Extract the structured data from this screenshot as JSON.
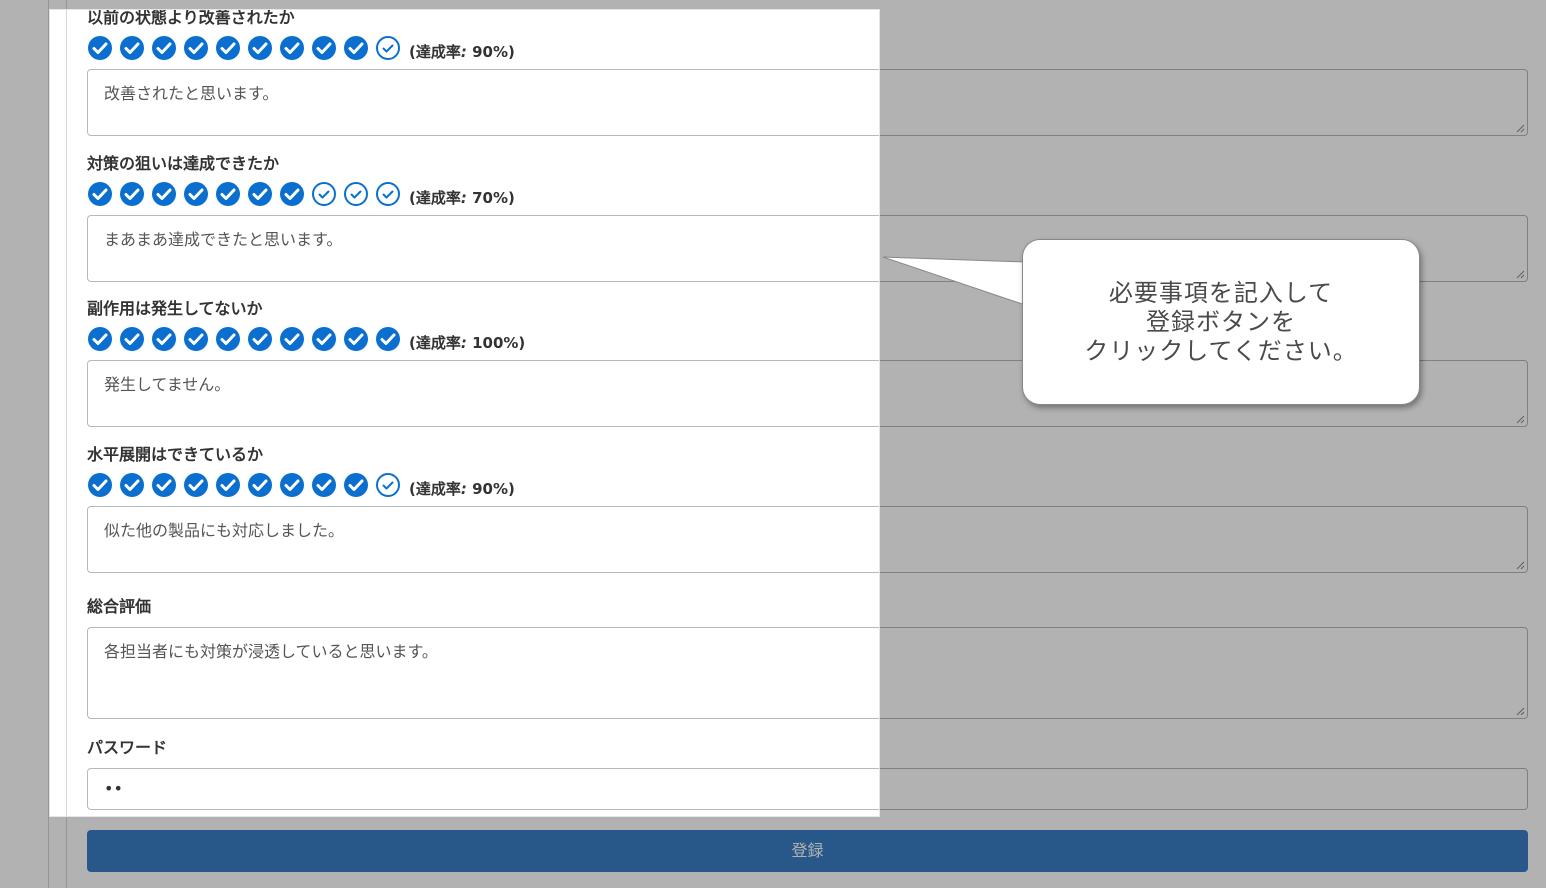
{
  "sections": [
    {
      "title": "以前の状態より改善されたか",
      "rate_label": "(達成率",
      "rate_colon": ":",
      "rate_value": " 90%)",
      "filled": 9,
      "textarea": "改善されたと思います。"
    },
    {
      "title": "対策の狙いは達成できたか",
      "rate_label": "(達成率",
      "rate_colon": ":",
      "rate_value": " 70%)",
      "filled": 7,
      "textarea": "まあまあ達成できたと思います。"
    },
    {
      "title": "副作用は発生してないか",
      "rate_label": "(達成率",
      "rate_colon": ":",
      "rate_value": " 100%)",
      "filled": 10,
      "textarea": "発生してません。"
    },
    {
      "title": "水平展開はできているか",
      "rate_label": "(達成率",
      "rate_colon": ":",
      "rate_value": " 90%)",
      "filled": 9,
      "textarea": "似た他の製品にも対応しました。"
    }
  ],
  "overall": {
    "title": "総合評価",
    "textarea": "各担当者にも対策が浸透していると思います。"
  },
  "password": {
    "title": "パスワード",
    "value": "••"
  },
  "register_button": "登録",
  "callout": {
    "line1": "必要事項を記入して",
    "line2": "登録ボタンを",
    "line3": "クリックしてください。"
  },
  "colors": {
    "check_blue": "#0b6fcf",
    "button_blue": "#3a7fc6",
    "overlay": "rgba(0,0,0,0.30)"
  }
}
